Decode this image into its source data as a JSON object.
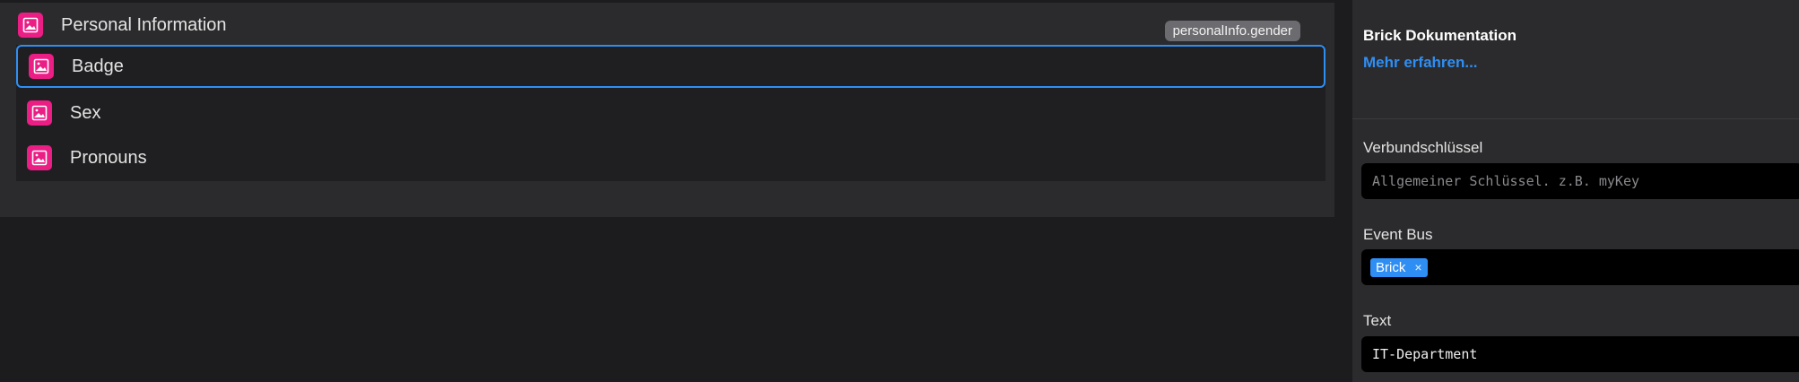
{
  "tree": {
    "parent": {
      "label": "Personal Information",
      "tag": "personalInfo.gender",
      "icon": "image-icon"
    },
    "children": [
      {
        "label": "Badge",
        "icon": "image-icon",
        "selected": true
      },
      {
        "label": "Sex",
        "icon": "image-icon",
        "selected": false
      },
      {
        "label": "Pronouns",
        "icon": "image-icon",
        "selected": false
      }
    ]
  },
  "inspector": {
    "doc_title": "Brick Dokumentation",
    "doc_link": "Mehr erfahren...",
    "fields": {
      "key": {
        "label": "Verbundschlüssel",
        "placeholder": "Allgemeiner Schlüssel. z.B. myKey",
        "value": ""
      },
      "event_bus": {
        "label": "Event Bus",
        "chip": "Brick",
        "chip_close": "×"
      },
      "text": {
        "label": "Text",
        "value": "IT-Department"
      }
    }
  },
  "colors": {
    "accent": "#2f8ef4",
    "icon_bg": "#ea1e84",
    "panel": "#2b2b2d",
    "background": "#1c1c1e"
  }
}
